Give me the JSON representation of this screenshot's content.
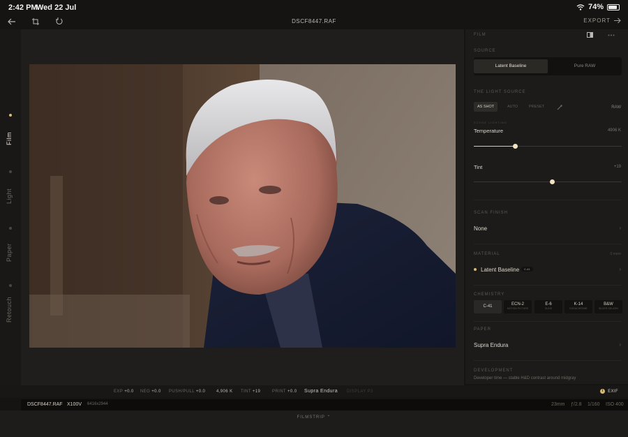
{
  "status_bar": {
    "time": "2:42 PM",
    "date": "Wed 22 Jul",
    "battery": "74%",
    "battery_level": 0.74
  },
  "toolbar": {
    "filename": "DSCF8447.RAF",
    "export_label": "EXPORT",
    "icons": [
      "back-arrow-icon",
      "crop-icon",
      "rotate-icon",
      "export-arrow-icon"
    ]
  },
  "left_rail": {
    "items": [
      {
        "label": "Film",
        "active": true
      },
      {
        "label": "Light",
        "active": false
      },
      {
        "label": "Paper",
        "active": false
      },
      {
        "label": "Retouch",
        "active": false
      }
    ]
  },
  "panel": {
    "header": "FILM",
    "source": {
      "label": "SOURCE",
      "options": [
        "Latent Baseline",
        "Pure RAW"
      ],
      "selected": "Latent Baseline"
    },
    "light_source": {
      "label": "THE LIGHT SOURCE",
      "buttons": [
        "AS SHOT",
        "AUTO",
        "PRESET"
      ],
      "selected": "AS SHOT",
      "raw_label": "RAW",
      "sub_label": "SCENE LIGHTING"
    },
    "temperature": {
      "label": "Temperature",
      "value": "4906 K",
      "fraction": 0.28
    },
    "tint": {
      "label": "Tint",
      "value": "+19",
      "fraction": 0.53
    },
    "scan_finish": {
      "label": "SCAN FINISH",
      "value": "None"
    },
    "material": {
      "label": "MATERIAL",
      "extra": "0 more",
      "value": "Latent Baseline",
      "badge": "C-41"
    },
    "chemistry": {
      "label": "CHEMISTRY",
      "items": [
        {
          "name": "C-41",
          "sub": ""
        },
        {
          "name": "ECN-2",
          "sub": "MOTION PICTURE"
        },
        {
          "name": "E-6",
          "sub": "SLIDE"
        },
        {
          "name": "K-14",
          "sub": "KODACHROME"
        },
        {
          "name": "B&W",
          "sub": "SILVER GELATIN"
        }
      ],
      "selected": "C-41"
    },
    "paper": {
      "label": "PAPER",
      "value": "Supra Endura"
    },
    "development": {
      "label": "DEVELOPMENT",
      "text": "Developer time — stable H&D contrast around midgray"
    },
    "accent": "#d8b974"
  },
  "bottom_info": {
    "items": [
      {
        "k": "EXP",
        "v": "+0.0"
      },
      {
        "k": "NEG",
        "v": "+0.0"
      },
      {
        "k": "PUSH/PULL",
        "v": "+0.0"
      },
      {
        "k": "",
        "v": "4,906 K"
      },
      {
        "k": "TINT",
        "v": "+19"
      },
      {
        "k": "PRINT",
        "v": "+0.0"
      },
      {
        "k": "",
        "v": "Supra Endura"
      }
    ],
    "display_label": "DISPLAY P3",
    "exif_label": "EXIF"
  },
  "meta_bar": {
    "filename": "DSCF8447.RAF",
    "camera": "X100V",
    "dimensions": "6416x2944",
    "focal": "23mm",
    "aperture": "ƒ/2.8",
    "shutter": "1/160",
    "iso": "ISO 400"
  },
  "filmstrip": {
    "label": "FILMSTRIP"
  }
}
